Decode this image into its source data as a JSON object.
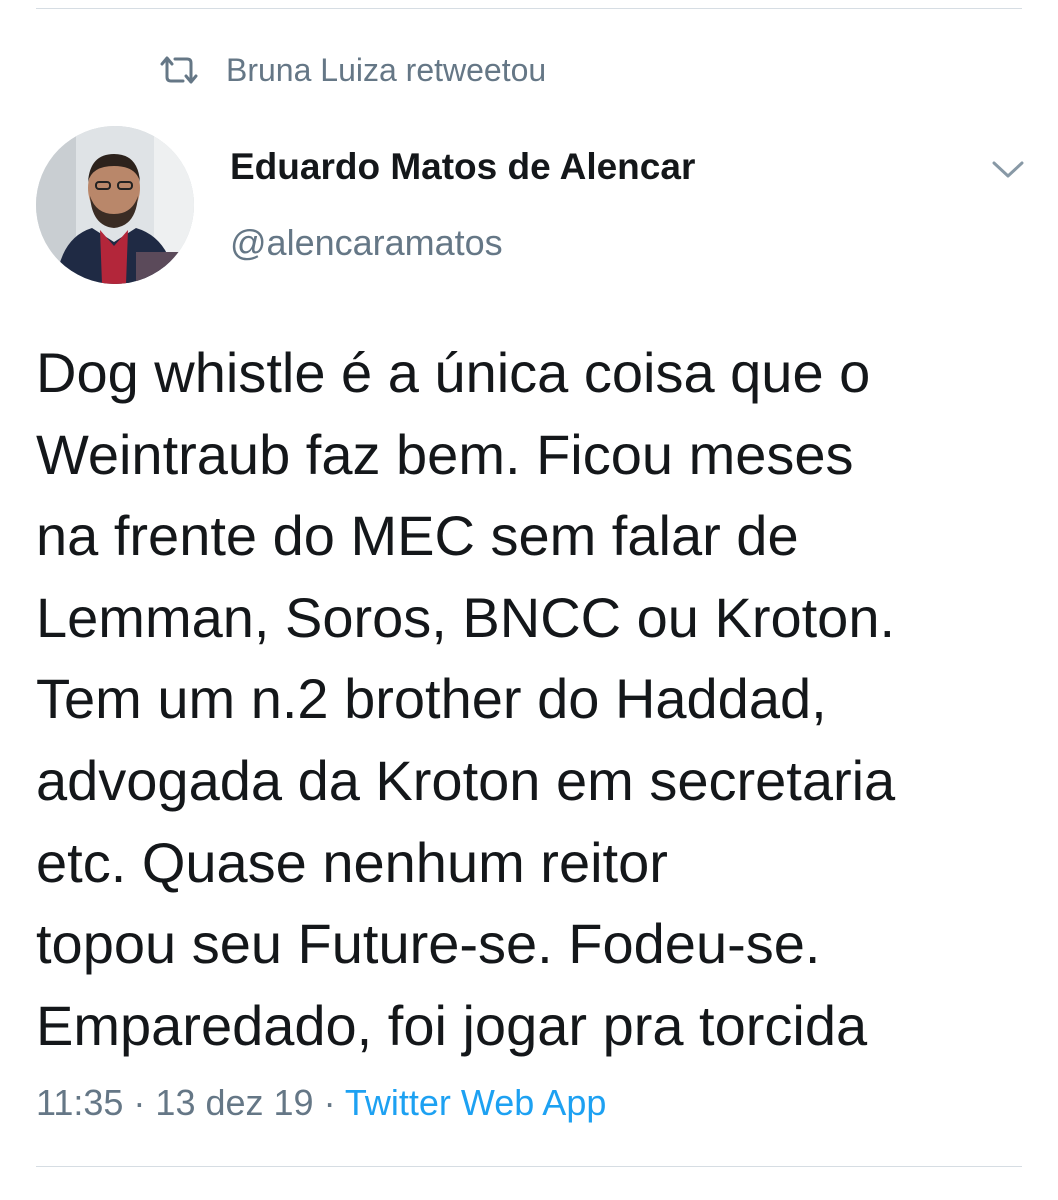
{
  "retweet": {
    "icon": "retweet-icon",
    "text": "Bruna Luiza retweetou"
  },
  "author": {
    "name": "Eduardo Matos de Alencar",
    "handle": "@alencaramatos",
    "avatar_icon": "avatar-photo"
  },
  "menu": {
    "icon": "chevron-down-icon"
  },
  "tweet": {
    "lines": [
      "Dog whistle é a única coisa que o",
      "Weintraub faz bem. Ficou meses",
      "na frente do MEC sem falar de",
      "Lemman, Soros, BNCC ou Kroton.",
      "Tem um n.2 brother do Haddad,",
      "advogada da Kroton em secretaria",
      "etc. Quase nenhum reitor",
      "topou seu Future-se. Fodeu-se.",
      "Emparedado, foi jogar pra torcida"
    ]
  },
  "meta": {
    "time": "11:35",
    "separator": " · ",
    "date": "13 dez 19",
    "app": "Twitter Web App"
  },
  "colors": {
    "text": "#14171a",
    "secondary": "#657786",
    "link": "#1da1f2",
    "divider": "#d6dde3"
  }
}
